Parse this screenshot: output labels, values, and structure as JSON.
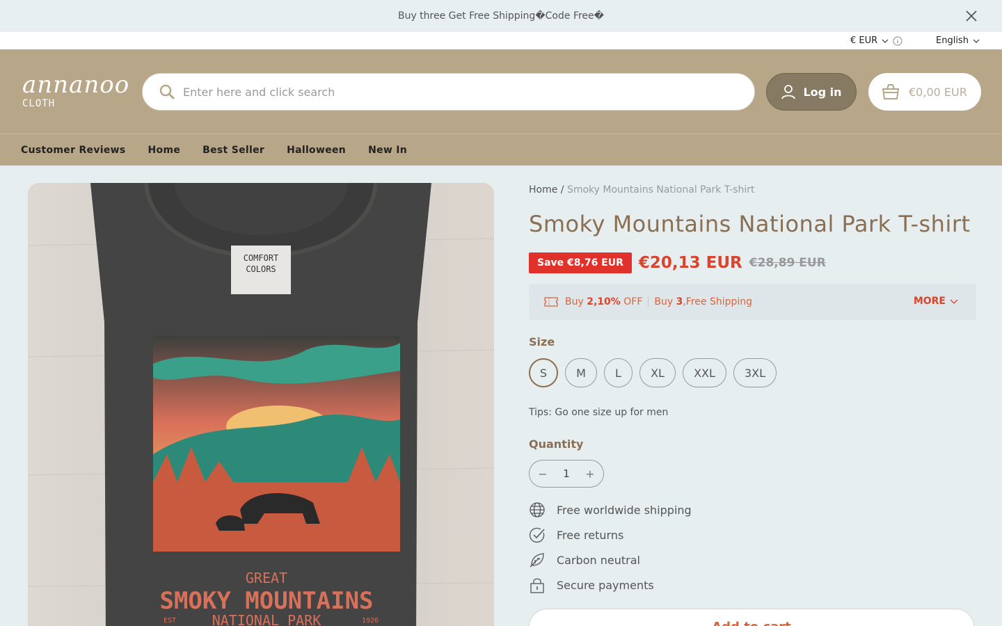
{
  "announcement": {
    "text": "Buy three Get Free Shipping�Code Free�"
  },
  "utility": {
    "currency": "€ EUR",
    "language": "English"
  },
  "header": {
    "logo": {
      "line1": "annanoo",
      "line2": "CLOTH"
    },
    "search": {
      "placeholder": "Enter here and click search"
    },
    "login_label": "Log in",
    "cart_total": "€0,00 EUR"
  },
  "nav": {
    "items": [
      "Customer Reviews",
      "Home",
      "Best Seller",
      "Halloween",
      "New In"
    ]
  },
  "product": {
    "breadcrumb": {
      "home": "Home",
      "sep": "/",
      "current": "Smoky Mountains National Park T-shirt"
    },
    "title": "Smoky Mountains National Park T-shirt",
    "save_badge": "Save €8,76 EUR",
    "price": "€20,13 EUR",
    "compare_price": "€28,89 EUR",
    "promo": {
      "offer1_pre": "Buy ",
      "offer1_bold": "2,10%",
      "offer1_post": " OFF",
      "offer2_pre": "Buy ",
      "offer2_bold": "3",
      "offer2_post": ",Free Shipping",
      "more": "MORE"
    },
    "size_label": "Size",
    "sizes": [
      "S",
      "M",
      "L",
      "XL",
      "XXL",
      "3XL"
    ],
    "selected_size": "S",
    "tips": "Tips: Go one size up for men",
    "quantity_label": "Quantity",
    "quantity": "1",
    "quantity_minus": "−",
    "quantity_plus": "+",
    "features": [
      "Free worldwide shipping",
      "Free returns",
      "Carbon neutral",
      "Secure payments"
    ],
    "add_to_cart": "Add to cart",
    "image": {
      "tag_line1": "COMFORT",
      "tag_line2": "COLORS",
      "print_line1": "GREAT",
      "print_line2": "SMOKY MOUNTAINS",
      "print_line3": "NATIONAL PARK",
      "print_est": "EST",
      "print_year": "1926"
    }
  },
  "colors": {
    "brand": "#b7a688",
    "accent": "#d9452c",
    "title": "#8a6f52"
  }
}
